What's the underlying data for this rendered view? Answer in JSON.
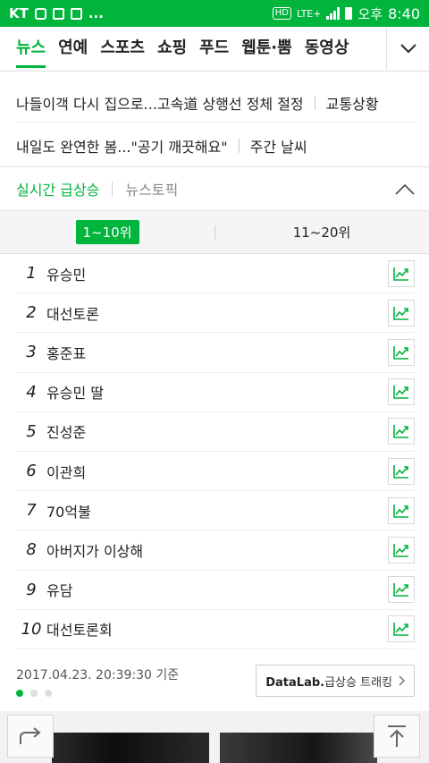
{
  "status_bar": {
    "carrier": "KT",
    "hd": "HD",
    "network": "LTE+",
    "ampm": "오후",
    "time": "8:40",
    "more": "..."
  },
  "category_nav": {
    "tabs": [
      "뉴스",
      "연예",
      "스포츠",
      "쇼핑",
      "푸드",
      "웹툰·뿜",
      "동영상"
    ],
    "active_index": 0,
    "accent_color": "#00b43c"
  },
  "headlines": [
    {
      "title": "나들이객 다시 집으로...고속道 상행선 정체 절정",
      "tag": "교통상황"
    },
    {
      "title": "내일도 완연한 봄...\"공기 깨끗해요\"",
      "tag": "주간 날씨"
    }
  ],
  "realtime": {
    "tab_active": "실시간 급상승",
    "tab_other": "뉴스토픽",
    "range_active": "1~10위",
    "range_other": "11~20위",
    "items": [
      {
        "rank": "1",
        "keyword": "유승민"
      },
      {
        "rank": "2",
        "keyword": "대선토론"
      },
      {
        "rank": "3",
        "keyword": "홍준표"
      },
      {
        "rank": "4",
        "keyword": "유승민 딸"
      },
      {
        "rank": "5",
        "keyword": "진성준"
      },
      {
        "rank": "6",
        "keyword": "이관희"
      },
      {
        "rank": "7",
        "keyword": "70억불"
      },
      {
        "rank": "8",
        "keyword": "아버지가 이상해"
      },
      {
        "rank": "9",
        "keyword": "유담"
      },
      {
        "rank": "10",
        "keyword": "대선토론회"
      }
    ],
    "timestamp": "2017.04.23. 20:39:30 기준",
    "datalab_brand": "DataLab.",
    "datalab_label": "급상승 트래킹",
    "page_dots": 3,
    "page_active": 0
  }
}
